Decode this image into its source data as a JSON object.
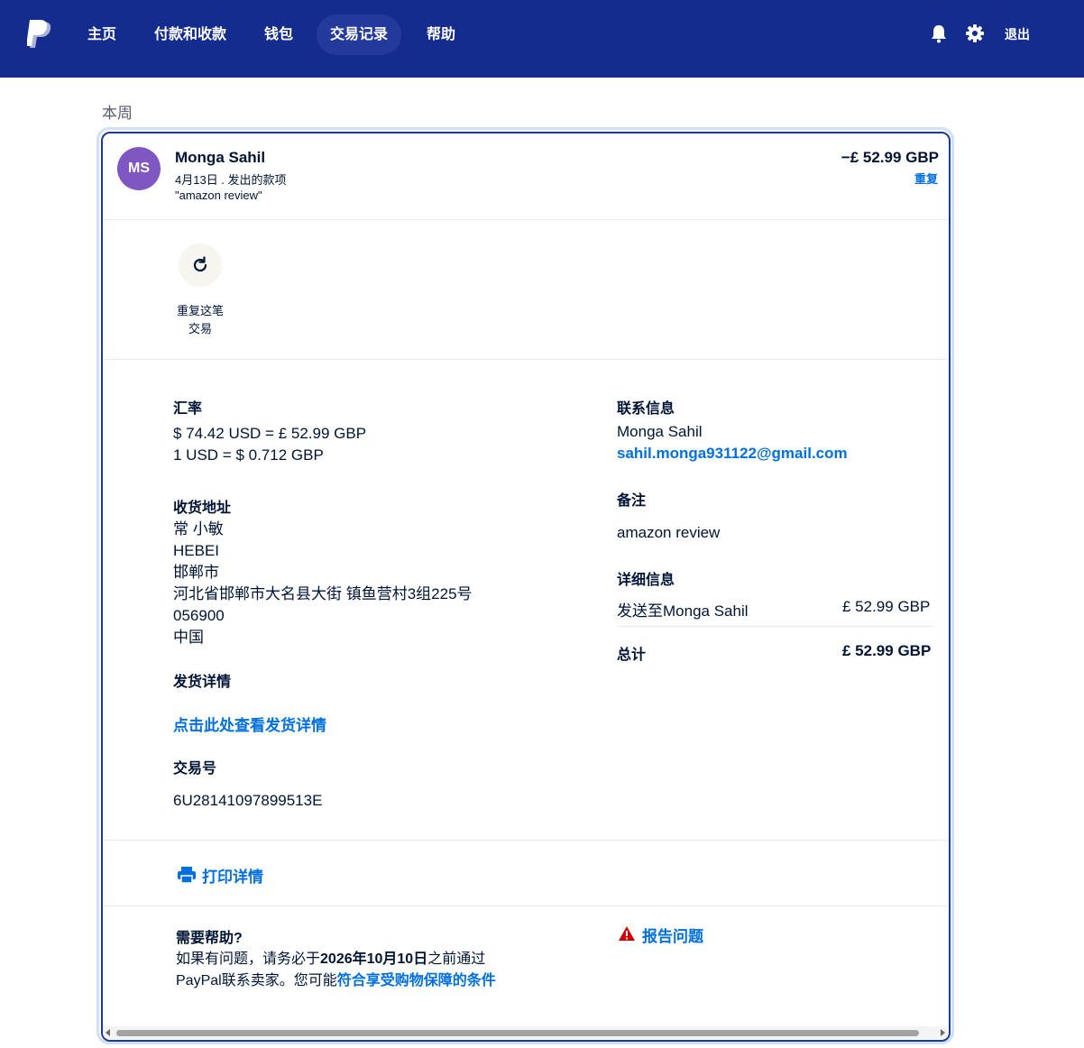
{
  "nav": {
    "items": [
      {
        "label": "主页",
        "active": false
      },
      {
        "label": "付款和收款",
        "active": false
      },
      {
        "label": "钱包",
        "active": false
      },
      {
        "label": "交易记录",
        "active": true
      },
      {
        "label": "帮助",
        "active": false
      }
    ],
    "logout": "退出",
    "icons": [
      "paypal-logo-icon",
      "bell-icon",
      "gear-icon"
    ]
  },
  "section_label": "本周",
  "transaction": {
    "avatar_initials": "MS",
    "avatar_color": "#7e57c2",
    "name": "Monga Sahil",
    "date_type": "4月13日 . 发出的款项",
    "note_quoted": "\"amazon review\"",
    "amount": "−£ 52.99 GBP",
    "repeat_link": "重复"
  },
  "repeat_action": {
    "line1": "重复这笔",
    "line2": "交易"
  },
  "exchange": {
    "heading": "汇率",
    "line1": "$ 74.42 USD = £ 52.99 GBP",
    "line2": "1 USD = $ 0.712 GBP"
  },
  "shipping_address": {
    "heading": "收货地址",
    "lines": [
      "常 小敏",
      "HEBEI",
      "邯郸市",
      "河北省邯郸市大名县大街 镇鱼营村3组225号",
      "056900",
      "中国"
    ]
  },
  "shipping_details": {
    "heading": "发货详情",
    "link": "点击此处查看发货详情"
  },
  "transaction_id": {
    "heading": "交易号",
    "value": "6U28141097899513E"
  },
  "contact": {
    "heading": "联系信息",
    "name": "Monga Sahil",
    "email": "sahil.monga931122@gmail.com"
  },
  "memo": {
    "heading": "备注",
    "value": "amazon review"
  },
  "details": {
    "heading": "详细信息",
    "sent_to_label": "发送至Monga Sahil",
    "sent_to_amount": "£ 52.99 GBP",
    "total_label": "总计",
    "total_amount": "£ 52.99 GBP"
  },
  "print": {
    "label": "打印详情"
  },
  "help": {
    "title": "需要帮助?",
    "text_before": "如果有问题，请务必于",
    "date": "2026年10月10日",
    "text_after": "之前通过PayPal联系卖家。您可能",
    "link": "符合享受购物保障的条件"
  },
  "report": {
    "label": "报告问题"
  },
  "colors": {
    "nav_bg": "#142c8e",
    "link": "#0070e0",
    "warning": "#d20000",
    "card_border": "#1a3b9a"
  }
}
